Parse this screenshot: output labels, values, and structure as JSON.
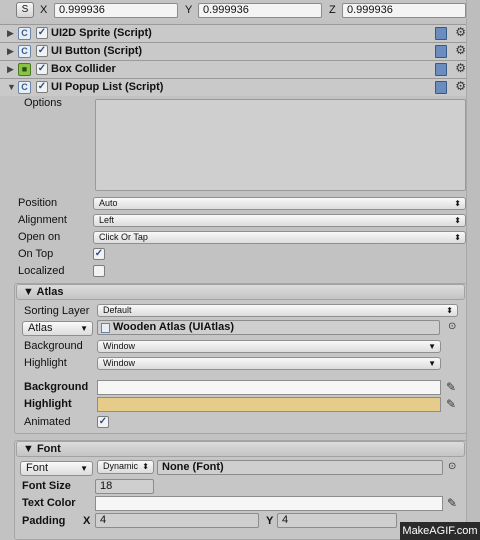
{
  "transform": {
    "s_button": "S",
    "x_label": "X",
    "x_value": "0.999936",
    "y_label": "Y",
    "y_value": "0.999936",
    "z_label": "Z",
    "z_value": "0.999936"
  },
  "components": [
    {
      "title": "UI2D Sprite (Script)",
      "icon": "script-icon"
    },
    {
      "title": "UI Button (Script)",
      "icon": "script-icon"
    },
    {
      "title": "Box Collider",
      "icon": "box-collider-icon"
    },
    {
      "title": "UI Popup List (Script)",
      "icon": "script-icon"
    }
  ],
  "popup": {
    "options_label": "Options",
    "position_label": "Position",
    "position_value": "Auto",
    "alignment_label": "Alignment",
    "alignment_value": "Left",
    "open_on_label": "Open on",
    "open_on_value": "Click Or Tap",
    "on_top_label": "On Top",
    "on_top_checked": true,
    "localized_label": "Localized",
    "localized_checked": false
  },
  "atlas": {
    "header": "Atlas",
    "sorting_layer_label": "Sorting Layer",
    "sorting_layer_value": "Default",
    "atlas_dropdown": "Atlas",
    "atlas_value": "Wooden Atlas (UIAtlas)",
    "background_label": "Background",
    "background_value": "Window",
    "highlight_label": "Highlight",
    "highlight_value": "Window",
    "background_color_label": "Background",
    "background_color": "#f6f6f6",
    "highlight_color_label": "Highlight",
    "highlight_color": "#e6cc8a",
    "animated_label": "Animated",
    "animated_checked": true
  },
  "font": {
    "header": "Font",
    "font_dropdown": "Font",
    "font_type": "Dynamic",
    "font_value": "None (Font)",
    "font_size_label": "Font Size",
    "font_size_value": "18",
    "text_color_label": "Text Color",
    "text_color": "#f6f6f6",
    "padding_label": "Padding",
    "padding_x_label": "X",
    "padding_x_value": "4",
    "padding_y_label": "Y",
    "padding_y_value": "4"
  },
  "watermark": "MakeAGIF.com"
}
